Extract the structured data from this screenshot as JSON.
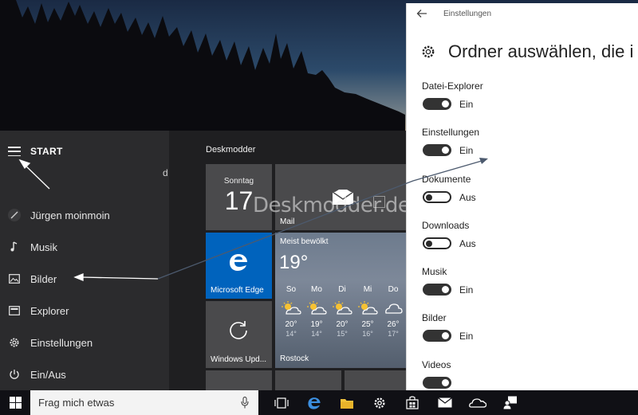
{
  "start_menu": {
    "title": "START",
    "stray_text": "d",
    "items": [
      {
        "label": "Jürgen moinmoin",
        "icon": "user-avatar-icon"
      },
      {
        "label": "Musik",
        "icon": "music-note-icon"
      },
      {
        "label": "Bilder",
        "icon": "picture-icon"
      },
      {
        "label": "Explorer",
        "icon": "file-explorer-icon"
      },
      {
        "label": "Einstellungen",
        "icon": "gear-icon"
      },
      {
        "label": "Ein/Aus",
        "icon": "power-icon"
      }
    ],
    "group_title": "Deskmodder",
    "tiles": {
      "calendar": {
        "day_name": "Sonntag",
        "day_number": "17"
      },
      "mail": {
        "label": "Mail"
      },
      "edge": {
        "label": "Microsoft Edge"
      },
      "update": {
        "label": "Windows Upd..."
      },
      "weather": {
        "condition": "Meist bewölkt",
        "current_temp": "19°",
        "location": "Rostock",
        "forecast": [
          {
            "day": "So",
            "high": "20°",
            "low": "14°",
            "icon": "partly-sunny-icon"
          },
          {
            "day": "Mo",
            "high": "19°",
            "low": "14°",
            "icon": "partly-sunny-icon"
          },
          {
            "day": "Di",
            "high": "20°",
            "low": "15°",
            "icon": "partly-sunny-icon"
          },
          {
            "day": "Mi",
            "high": "25°",
            "low": "16°",
            "icon": "partly-sunny-icon"
          },
          {
            "day": "Do",
            "high": "26°",
            "low": "17°",
            "icon": "cloudy-icon"
          }
        ]
      }
    },
    "watermark": "Deskmodder.de"
  },
  "settings": {
    "window_title": "Einstellungen",
    "heading": "Ordner auswählen, die i",
    "toggles": [
      {
        "label": "Datei-Explorer",
        "state": "Ein",
        "on": true
      },
      {
        "label": "Einstellungen",
        "state": "Ein",
        "on": true
      },
      {
        "label": "Dokumente",
        "state": "Aus",
        "on": false
      },
      {
        "label": "Downloads",
        "state": "Aus",
        "on": false
      },
      {
        "label": "Musik",
        "state": "Ein",
        "on": true
      },
      {
        "label": "Bilder",
        "state": "Ein",
        "on": true
      },
      {
        "label": "Videos",
        "state": "",
        "on": true
      }
    ]
  },
  "taskbar": {
    "search_placeholder": "Frag mich etwas",
    "icons": [
      "task-view-icon",
      "edge-icon",
      "file-explorer-icon",
      "settings-gear-icon",
      "store-icon",
      "mail-icon",
      "onedrive-icon",
      "people-icon"
    ]
  },
  "colors": {
    "start_bg": "#202022",
    "tile_gray": "#4a4a4c",
    "edge_blue": "#0063bd",
    "taskbar_bg": "#101015"
  }
}
